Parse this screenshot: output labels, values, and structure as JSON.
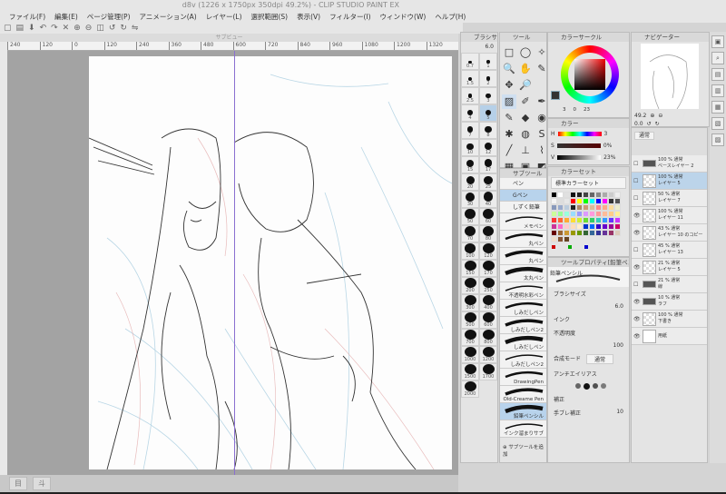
{
  "window": {
    "title": "d8v (1226 x 1750px 350dpi 49.2%) - CLIP STUDIO PAINT EX"
  },
  "menu": [
    "ファイル(F)",
    "編集(E)",
    "ページ管理(P)",
    "アニメーション(A)",
    "レイヤー(L)",
    "選択範囲(S)",
    "表示(V)",
    "フィルター(I)",
    "ウィンドウ(W)",
    "ヘルプ(H)"
  ],
  "toolbar_icons": [
    "new-icon",
    "open-icon",
    "save-icon",
    "undo-icon",
    "redo-icon",
    "clear-icon",
    "zoom-in-icon",
    "zoom-out-icon",
    "zoom-fit-icon",
    "rotate-left-icon",
    "rotate-right-icon",
    "flip-icon"
  ],
  "view_tab": "サブビュー",
  "ruler_ticks": [
    "240",
    "120",
    "0",
    "120",
    "240",
    "360",
    "480",
    "600",
    "720",
    "840",
    "960",
    "1080",
    "1200",
    "1320"
  ],
  "status_buttons": [
    "目",
    "斗"
  ],
  "brush_size": {
    "title": "ブラシサイズ",
    "value": "6.0",
    "sizes": [
      "0.7",
      "1",
      "1.5",
      "2",
      "2.5",
      "3",
      "4",
      "5",
      "7",
      "8",
      "10",
      "12",
      "15",
      "17",
      "20",
      "25",
      "30",
      "40",
      "50",
      "60",
      "70",
      "80",
      "100",
      "120",
      "150",
      "170",
      "200",
      "250",
      "300",
      "400",
      "500",
      "600",
      "700",
      "800",
      "1000",
      "1200",
      "1500",
      "1700",
      "2000"
    ],
    "selected": "5"
  },
  "tool_panel": {
    "title": "ツール",
    "icons": [
      "□",
      "◯",
      "✧",
      "🔍",
      "✋",
      "✎",
      "✥",
      "🔎",
      "",
      "▨",
      "✐",
      "✒",
      "✎",
      "◆",
      "◉",
      "✱",
      "◍",
      "S",
      "╱",
      "⊥",
      "⌇",
      "▦",
      "▣",
      "◩",
      "A",
      "⊢",
      "◯"
    ]
  },
  "sub_tool": {
    "title": "サブツール",
    "groups": [
      "ペン",
      "Gペン",
      "しずく鉛筆"
    ],
    "selected_group": "Gペン",
    "brushes": [
      "メモペン",
      "丸ペン",
      "丸ペン",
      "太丸ペン",
      "不透明水彩ペン",
      "しみだしペン",
      "しみだしペン2",
      "しみだしペン",
      "しみだしペン2",
      "DrawingPen",
      "Old-Creame Pen",
      "鉛筆ペンシル",
      "インク溜まりサブ"
    ],
    "selected_brush": "鉛筆ペンシル",
    "add_label": "サブツールを追加"
  },
  "color_circle": {
    "title": "カラーサークル",
    "readout": [
      "3",
      "0",
      "23"
    ]
  },
  "color_sliders": {
    "tab": "カラー",
    "rows": [
      {
        "label": "H",
        "value": "3"
      },
      {
        "label": "S",
        "value": "0%"
      },
      {
        "label": "V",
        "value": "23%"
      }
    ]
  },
  "color_set": {
    "title": "カラーセット",
    "set_name": "標準カラーセット",
    "swatches": [
      "#000000",
      "#ffffff",
      "#e0e0e0",
      "#111111",
      "#222222",
      "#444444",
      "#666666",
      "#888888",
      "#aaaaaa",
      "#cccccc",
      "#eeeeee",
      "#f4f4f4",
      "#dddddd",
      "#e6e6e6",
      "#ff0000",
      "#ffff00",
      "#00ff00",
      "#00ffff",
      "#0000ff",
      "#ff00ff",
      "#333333",
      "#555555",
      "#8899bb",
      "#99aacc",
      "#bbccdd",
      "#222222",
      "#aa8866",
      "#cc9977",
      "#ddbb99",
      "#ff8888",
      "#ffaa88",
      "#ffdd99",
      "#eeeecc",
      "#ccff99",
      "#99ff99",
      "#99ffdd",
      "#99ddff",
      "#9999ff",
      "#dd99ff",
      "#ff99dd",
      "#ff9999",
      "#ffbb99",
      "#ffcc88",
      "#ffee99",
      "#ff3333",
      "#ff6633",
      "#ffaa33",
      "#ffdd33",
      "#ccee33",
      "#66dd33",
      "#33cc66",
      "#33ccbb",
      "#3399ff",
      "#6633ff",
      "#cc33ff",
      "#cc3399",
      "#ff66cc",
      "#ffcccc",
      "#ffddbb",
      "#ffeecc",
      "#0033cc",
      "#0066ff",
      "#3300cc",
      "#6600cc",
      "#990099",
      "#cc0066",
      "#660000",
      "#996633",
      "#cc9933",
      "#999900",
      "#669900",
      "#336633",
      "#336699",
      "#333399",
      "#663399",
      "#993366",
      "#ddccbb",
      "#eeddcc",
      "#885533",
      "#664422"
    ],
    "markers": [
      "#cc0000",
      "#00aa00",
      "#0000cc"
    ]
  },
  "tool_property": {
    "title": "ツールプロパティ[鉛筆ペンシル]",
    "brush_name": "鉛筆ペンシル",
    "brush_size_label": "ブラシサイズ",
    "brush_size_value": "6.0",
    "ink_label": "インク",
    "opacity_label": "不透明度",
    "opacity_value": "100",
    "blend_label": "合成モード",
    "blend_value": "通常",
    "antialias_label": "アンチエイリアス",
    "correction_label": "補正",
    "stabilization_label": "手ブレ補正",
    "stabilization_value": "10"
  },
  "navigator": {
    "title": "ナビゲーター",
    "zoom": "49.2",
    "rotation": "0.0"
  },
  "layers": {
    "blend": "通常",
    "items": [
      {
        "opacity": "100 % 通常",
        "name": "ベースレイヤー 2",
        "folder": true,
        "visible": false
      },
      {
        "opacity": "100 % 通常",
        "name": "レイヤー 5",
        "selected": true,
        "visible": false
      },
      {
        "opacity": "50 % 通常",
        "name": "レイヤー 7",
        "visible": false
      },
      {
        "opacity": "100 % 通常",
        "name": "レイヤー 11",
        "visible": true
      },
      {
        "opacity": "43 % 通常",
        "name": "レイヤー 10 のコピー",
        "visible": true
      },
      {
        "opacity": "45 % 通常",
        "name": "レイヤー 13",
        "visible": false
      },
      {
        "opacity": "21 % 通常",
        "name": "レイヤー 5",
        "visible": true
      },
      {
        "opacity": "21 % 通常",
        "name": "線",
        "folder": true,
        "visible": false
      },
      {
        "opacity": "10 % 通常",
        "name": "ラフ",
        "folder": true,
        "visible": true
      },
      {
        "opacity": "100 % 通常",
        "name": "下書き",
        "visible": true
      },
      {
        "opacity": "",
        "name": "用紙",
        "visible": true
      }
    ]
  },
  "colors": {
    "accent": "#b8d3ec",
    "guide": "#8a6fd0",
    "canvas_bg": "#a3a3a3"
  }
}
